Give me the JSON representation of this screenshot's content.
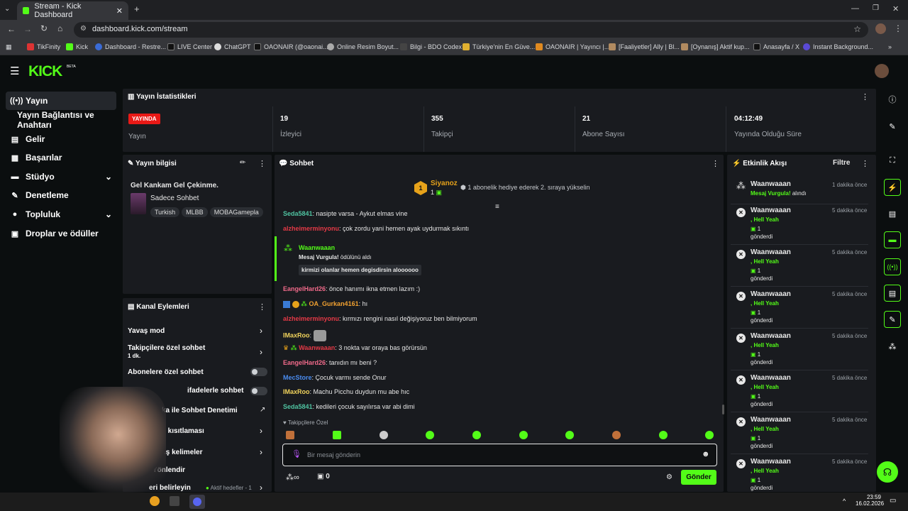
{
  "browser": {
    "tab_title": "Stream - Kick Dashboard",
    "url": "dashboard.kick.com/stream",
    "bookmarks": [
      "TikFinity",
      "Kick",
      "Dashboard - Restre...",
      "LIVE Center",
      "ChatGPT",
      "OAONAIR (@oaonai...",
      "Online Resim Boyut...",
      "Bilgi - BDO Codex",
      "Türkiye'nin En Güve...",
      "OAONAIR | Yayıncı |...",
      "[Faaliyetler] Ally | Bl...",
      "[Oynanış] Aktif kup...",
      "Anasayfa / X",
      "Instant Background..."
    ]
  },
  "header": {
    "logo": "KICK",
    "logo_badge": "BETA"
  },
  "sidebar": {
    "items": [
      "Yayın",
      "Yayın Bağlantısı ve Anahtarı",
      "Gelir",
      "Başarılar",
      "Stüdyo",
      "Denetleme",
      "Topluluk",
      "Droplar ve ödüller"
    ]
  },
  "stats": {
    "title": "Yayın İstatistikleri",
    "live_badge": "YAYINDA",
    "live_label": "Yayın",
    "viewers": "19",
    "viewers_label": "İzleyici",
    "followers": "355",
    "followers_label": "Takipçi",
    "subs": "21",
    "subs_label": "Abone Sayısı",
    "uptime": "04:12:49",
    "uptime_label": "Yayında Olduğu Süre"
  },
  "stream_info": {
    "title": "Yayın bilgisi",
    "stream_title": "Gel Kankam Gel Çekinme.",
    "category": "Sadece Sohbet",
    "tags": [
      "Turkish",
      "MLBB",
      "MOBAGamepla"
    ]
  },
  "channel_actions": {
    "title": "Kanal Eylemleri",
    "items": [
      "Yavaş mod",
      "Takipçilere özel sohbet",
      "1 dk.",
      "Abonelere özel sohbet",
      "ifadelerle sohbet",
      "ka ile Sohbet Denetimi",
      "aşı kısıtlaması",
      "nmış kelimeler",
      "ci Yönlendir",
      "eri belirleyin",
      "Aktif hedefler - 1"
    ]
  },
  "chat": {
    "title": "Sohbet",
    "top_gifter": "Siyanoz",
    "top_gifter_count": "1",
    "gift_hint": "1 abonelik hediye ederek 2. sıraya yükselin",
    "messages": [
      {
        "user": "Seda5841",
        "text": ": nasipte varsa - Aykut elmas vine",
        "color": "#4fc3a1"
      },
      {
        "user": "alzheimerminyonu",
        "text": ": çok zordu yani hemen ayak uydurmak sıkıntı",
        "color": "#e53946"
      },
      {
        "user": "EangelHard26",
        "text": ": önce hanımı ikna etmen lazım :)",
        "color": "#f06a8a"
      },
      {
        "user": "OA_Gurkan4161",
        "text": ": hı",
        "color": "#f0a030"
      },
      {
        "user": "alzheimerminyonu",
        "text": ": kırmızı rengini nasıl değişiyoruz ben bilmiyorum",
        "color": "#e53946"
      },
      {
        "user": "IMaxRoo",
        "text": ":",
        "color": "#f2d45c"
      },
      {
        "user": "Waanwaaan",
        "text": ": 3 nokta var oraya bas görürsün",
        "color": "#e53946"
      },
      {
        "user": "EangelHard26",
        "text": ": tanıdın mı beni ?",
        "color": "#f06a8a"
      },
      {
        "user": "MecStore",
        "text": ": Çocuk varmı sende Onur",
        "color": "#4a8cf0"
      },
      {
        "user": "IMaxRoo",
        "text": ": Machu Picchu duydun mu abe hıc",
        "color": "#f2d45c"
      },
      {
        "user": "Seda5841",
        "text": ": kedileri çocuk sayılırsa var abi dimi",
        "color": "#4fc3a1"
      }
    ],
    "redeem_user": "Waanwaaan",
    "redeem_reward": "Mesaj Vurgula!",
    "redeem_suffix": "ödülünü aldı",
    "redeem_message": "kirmizi olanlar hemen degisdirsin aloooooo",
    "followers_only": "Takipçilere Özel",
    "input_placeholder": "Bir mesaj gönderin",
    "points": "0",
    "send_label": "Gönder"
  },
  "activity": {
    "title": "Etkinlik Akışı",
    "filter": "Filtre",
    "first": {
      "user": "Waanwaaan",
      "reward": "Mesaj Vurgula!",
      "suffix": "alındı",
      "time": "1 dakika önce"
    },
    "items": [
      {
        "user": "Waanwaaan",
        "line": ", Hell Yeah",
        "count": "1",
        "sent": "gönderdi",
        "time": "5 dakika önce"
      },
      {
        "user": "Waanwaaan",
        "line": ", Hell Yeah",
        "count": "1",
        "sent": "gönderdi",
        "time": "5 dakika önce"
      },
      {
        "user": "Waanwaaan",
        "line": ", Hell Yeah",
        "count": "1",
        "sent": "gönderdi",
        "time": "5 dakika önce"
      },
      {
        "user": "Waanwaaan",
        "line": ", Hell Yeah",
        "count": "1",
        "sent": "gönderdi",
        "time": "5 dakika önce"
      },
      {
        "user": "Waanwaaan",
        "line": ", Hell Yeah",
        "count": "1",
        "sent": "gönderdi",
        "time": "5 dakika önce"
      },
      {
        "user": "Waanwaaan",
        "line": ", Hell Yeah",
        "count": "1",
        "sent": "gönderdi",
        "time": "5 dakika önce"
      },
      {
        "user": "Waanwaaan",
        "line": ", Hell Yeah",
        "count": "1",
        "sent": "gönderdi",
        "time": "5 dakika önce"
      }
    ]
  },
  "taskbar": {
    "time": "23:59",
    "date": "16.02.2026"
  },
  "colors": {
    "accent": "#53fc18",
    "live": "#e91916",
    "panel": "#191b1f"
  }
}
